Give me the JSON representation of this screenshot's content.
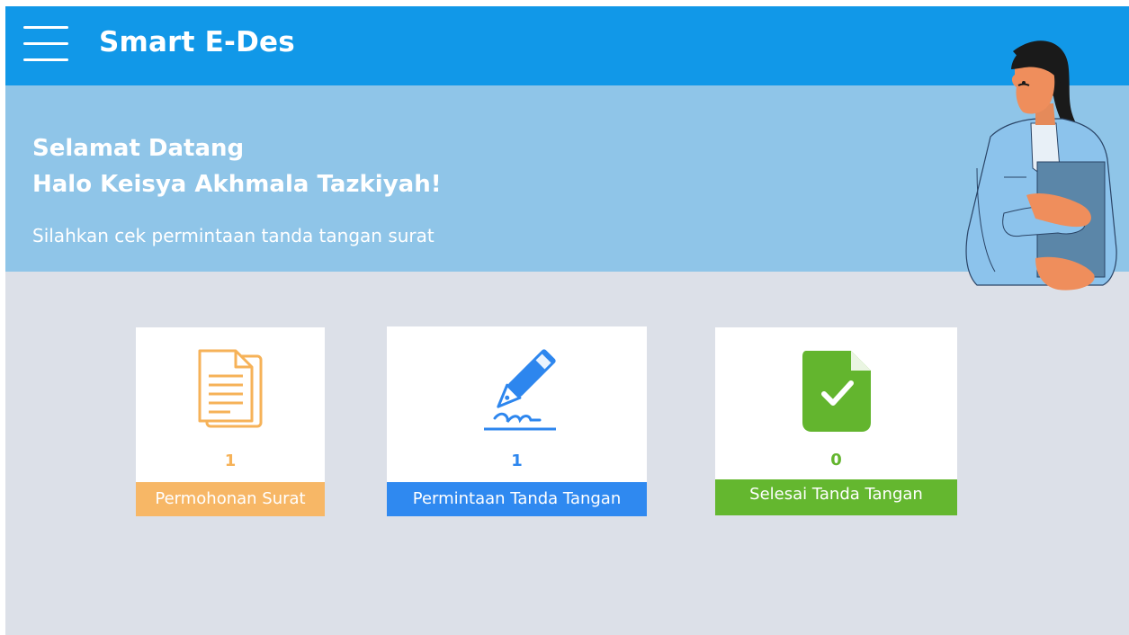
{
  "header": {
    "title": "Smart E-Des",
    "menu_icon": "hamburger-menu-icon"
  },
  "hero": {
    "greeting": "Selamat Datang",
    "name_line": "Halo Keisya Akhmala Tazkiyah!",
    "subtitle": "Silahkan cek permintaan tanda tangan  surat"
  },
  "cards": [
    {
      "label": "Permohonan Surat",
      "count": "1",
      "icon": "document-icon",
      "color": "#f7b766"
    },
    {
      "label": "Permintaan Tanda Tangan",
      "count": "1",
      "icon": "pen-signature-icon",
      "color": "#2f89f0"
    },
    {
      "label": "Selesai Tanda Tangan",
      "count": "0",
      "icon": "file-check-icon",
      "color": "#64b72f"
    }
  ],
  "colors": {
    "topbar": "#1198e8",
    "hero": "#8fc5e8",
    "background": "#dce0e8"
  }
}
